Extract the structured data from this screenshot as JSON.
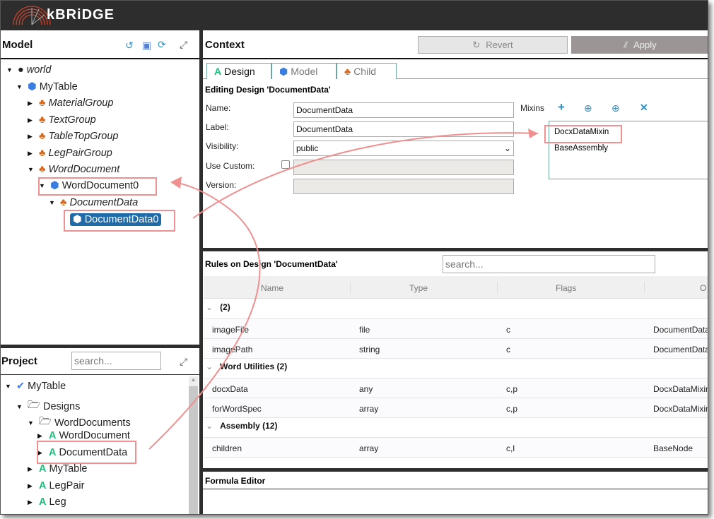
{
  "app": {
    "brand": "kBRiDGE"
  },
  "model_panel": {
    "title": "Model",
    "icons": [
      "history-icon",
      "save-icon",
      "refresh-icon",
      "expand-icon"
    ],
    "tree": [
      {
        "label": "world",
        "icon": "globe-icon",
        "italic": true,
        "expanded": true
      },
      {
        "label": "MyTable",
        "icon": "cube-icon",
        "expanded": true
      },
      {
        "label": "MaterialGroup",
        "icon": "hierarchy-icon",
        "italic": true
      },
      {
        "label": "TextGroup",
        "icon": "hierarchy-icon",
        "italic": true
      },
      {
        "label": "TableTopGroup",
        "icon": "hierarchy-icon",
        "italic": true
      },
      {
        "label": "LegPairGroup",
        "icon": "hierarchy-icon",
        "italic": true
      },
      {
        "label": "WordDocument",
        "icon": "hierarchy-icon",
        "italic": true,
        "expanded": true
      },
      {
        "label": "WordDocument0",
        "icon": "cube-icon",
        "expanded": true
      },
      {
        "label": "DocumentData",
        "icon": "hierarchy-icon",
        "italic": true,
        "expanded": true
      },
      {
        "label": "DocumentData0",
        "icon": "cube-icon",
        "selected": true
      }
    ]
  },
  "project_panel": {
    "title": "Project",
    "search_placeholder": "search...",
    "tree": [
      {
        "label": "MyTable",
        "icon": "check-circle-icon"
      },
      {
        "label": "Designs",
        "icon": "folder-open-icon"
      },
      {
        "label": "WordDocuments",
        "icon": "folder-open-icon"
      },
      {
        "label": "WordDocument",
        "icon": "design-icon"
      },
      {
        "label": "DocumentData",
        "icon": "design-icon"
      },
      {
        "label": "MyTable",
        "icon": "design-icon"
      },
      {
        "label": "LegPair",
        "icon": "design-icon"
      },
      {
        "label": "Leg",
        "icon": "design-icon"
      }
    ]
  },
  "context": {
    "title": "Context",
    "revert_label": "Revert",
    "apply_label": "Apply",
    "tabs": [
      {
        "label": "Design",
        "active": true
      },
      {
        "label": "Model"
      },
      {
        "label": "Child"
      }
    ],
    "editing_title": "Editing Design 'DocumentData'",
    "form": {
      "name_label": "Name:",
      "name_value": "DocumentData",
      "label_label": "Label:",
      "label_value": "DocumentData",
      "visibility_label": "Visibility:",
      "visibility_value": "public",
      "use_custom_label": "Use Custom:",
      "version_label": "Version:"
    },
    "mixins": {
      "label": "Mixins",
      "items": [
        "DocxDataMixin",
        "BaseAssembly"
      ]
    }
  },
  "rules": {
    "title": "Rules on Design 'DocumentData'",
    "search_placeholder": "search...",
    "columns": [
      "Name",
      "Type",
      "Flags",
      "O"
    ],
    "groups": [
      {
        "label": "(2)",
        "rows": [
          [
            "imageFile",
            "file",
            "c",
            "DocumentData"
          ],
          [
            "imagePath",
            "string",
            "c",
            "DocumentData"
          ]
        ]
      },
      {
        "label": "Word Utilities (2)",
        "rows": [
          [
            "docxData",
            "any",
            "c,p",
            "DocxDataMixin"
          ],
          [
            "forWordSpec",
            "array",
            "c,p",
            "DocxDataMixin"
          ]
        ]
      },
      {
        "label": "Assembly (12)",
        "rows": [
          [
            "children",
            "array",
            "c,l",
            "BaseNode"
          ]
        ]
      }
    ]
  },
  "formula_editor": {
    "title": "Formula Editor"
  },
  "colors": {
    "accent": "#2a8fc7",
    "selection": "#1f6aa8",
    "annotation": "#f08c8c",
    "topbar": "#2d2d2d"
  }
}
